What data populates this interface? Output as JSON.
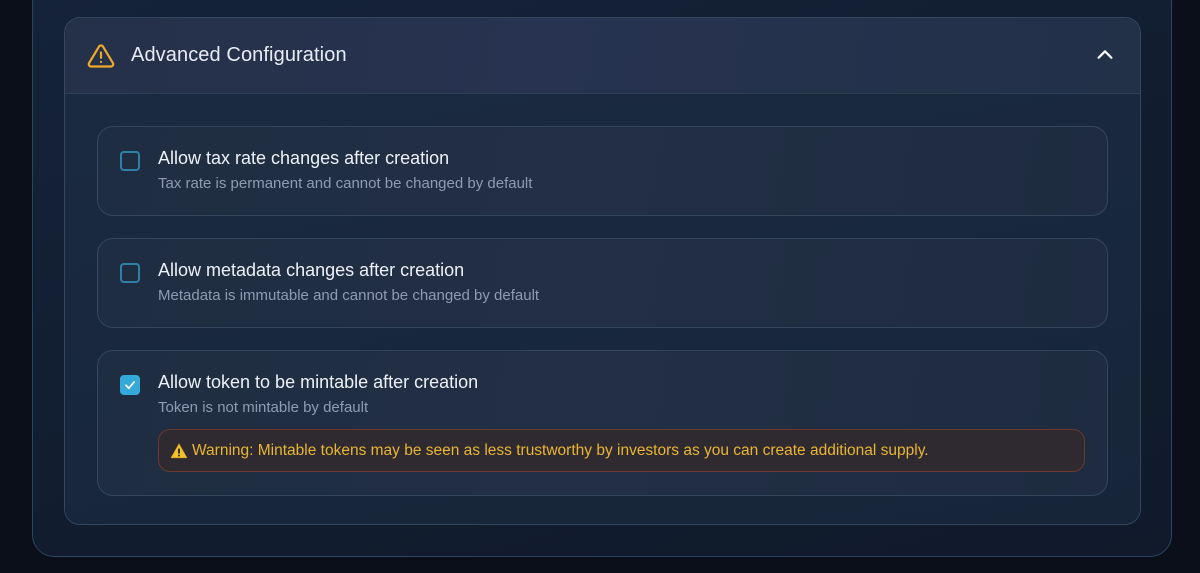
{
  "panel": {
    "title": "Advanced Configuration",
    "header_icon": "warning-triangle-icon",
    "collapse_icon": "chevron-up-icon",
    "accent_color": "#f0a82a"
  },
  "options": [
    {
      "title": "Allow tax rate changes after creation",
      "description": "Tax rate is permanent and cannot be changed by default",
      "checked": false
    },
    {
      "title": "Allow metadata changes after creation",
      "description": "Metadata is immutable and cannot be changed by default",
      "checked": false
    },
    {
      "title": "Allow token to be mintable after creation",
      "description": "Token is not mintable by default",
      "checked": true,
      "warning": "Warning: Mintable tokens may be seen as less trustworthy by investors as you can create additional supply."
    }
  ],
  "colors": {
    "checkbox_checked": "#35a9d8",
    "warning_text": "#eab530"
  }
}
